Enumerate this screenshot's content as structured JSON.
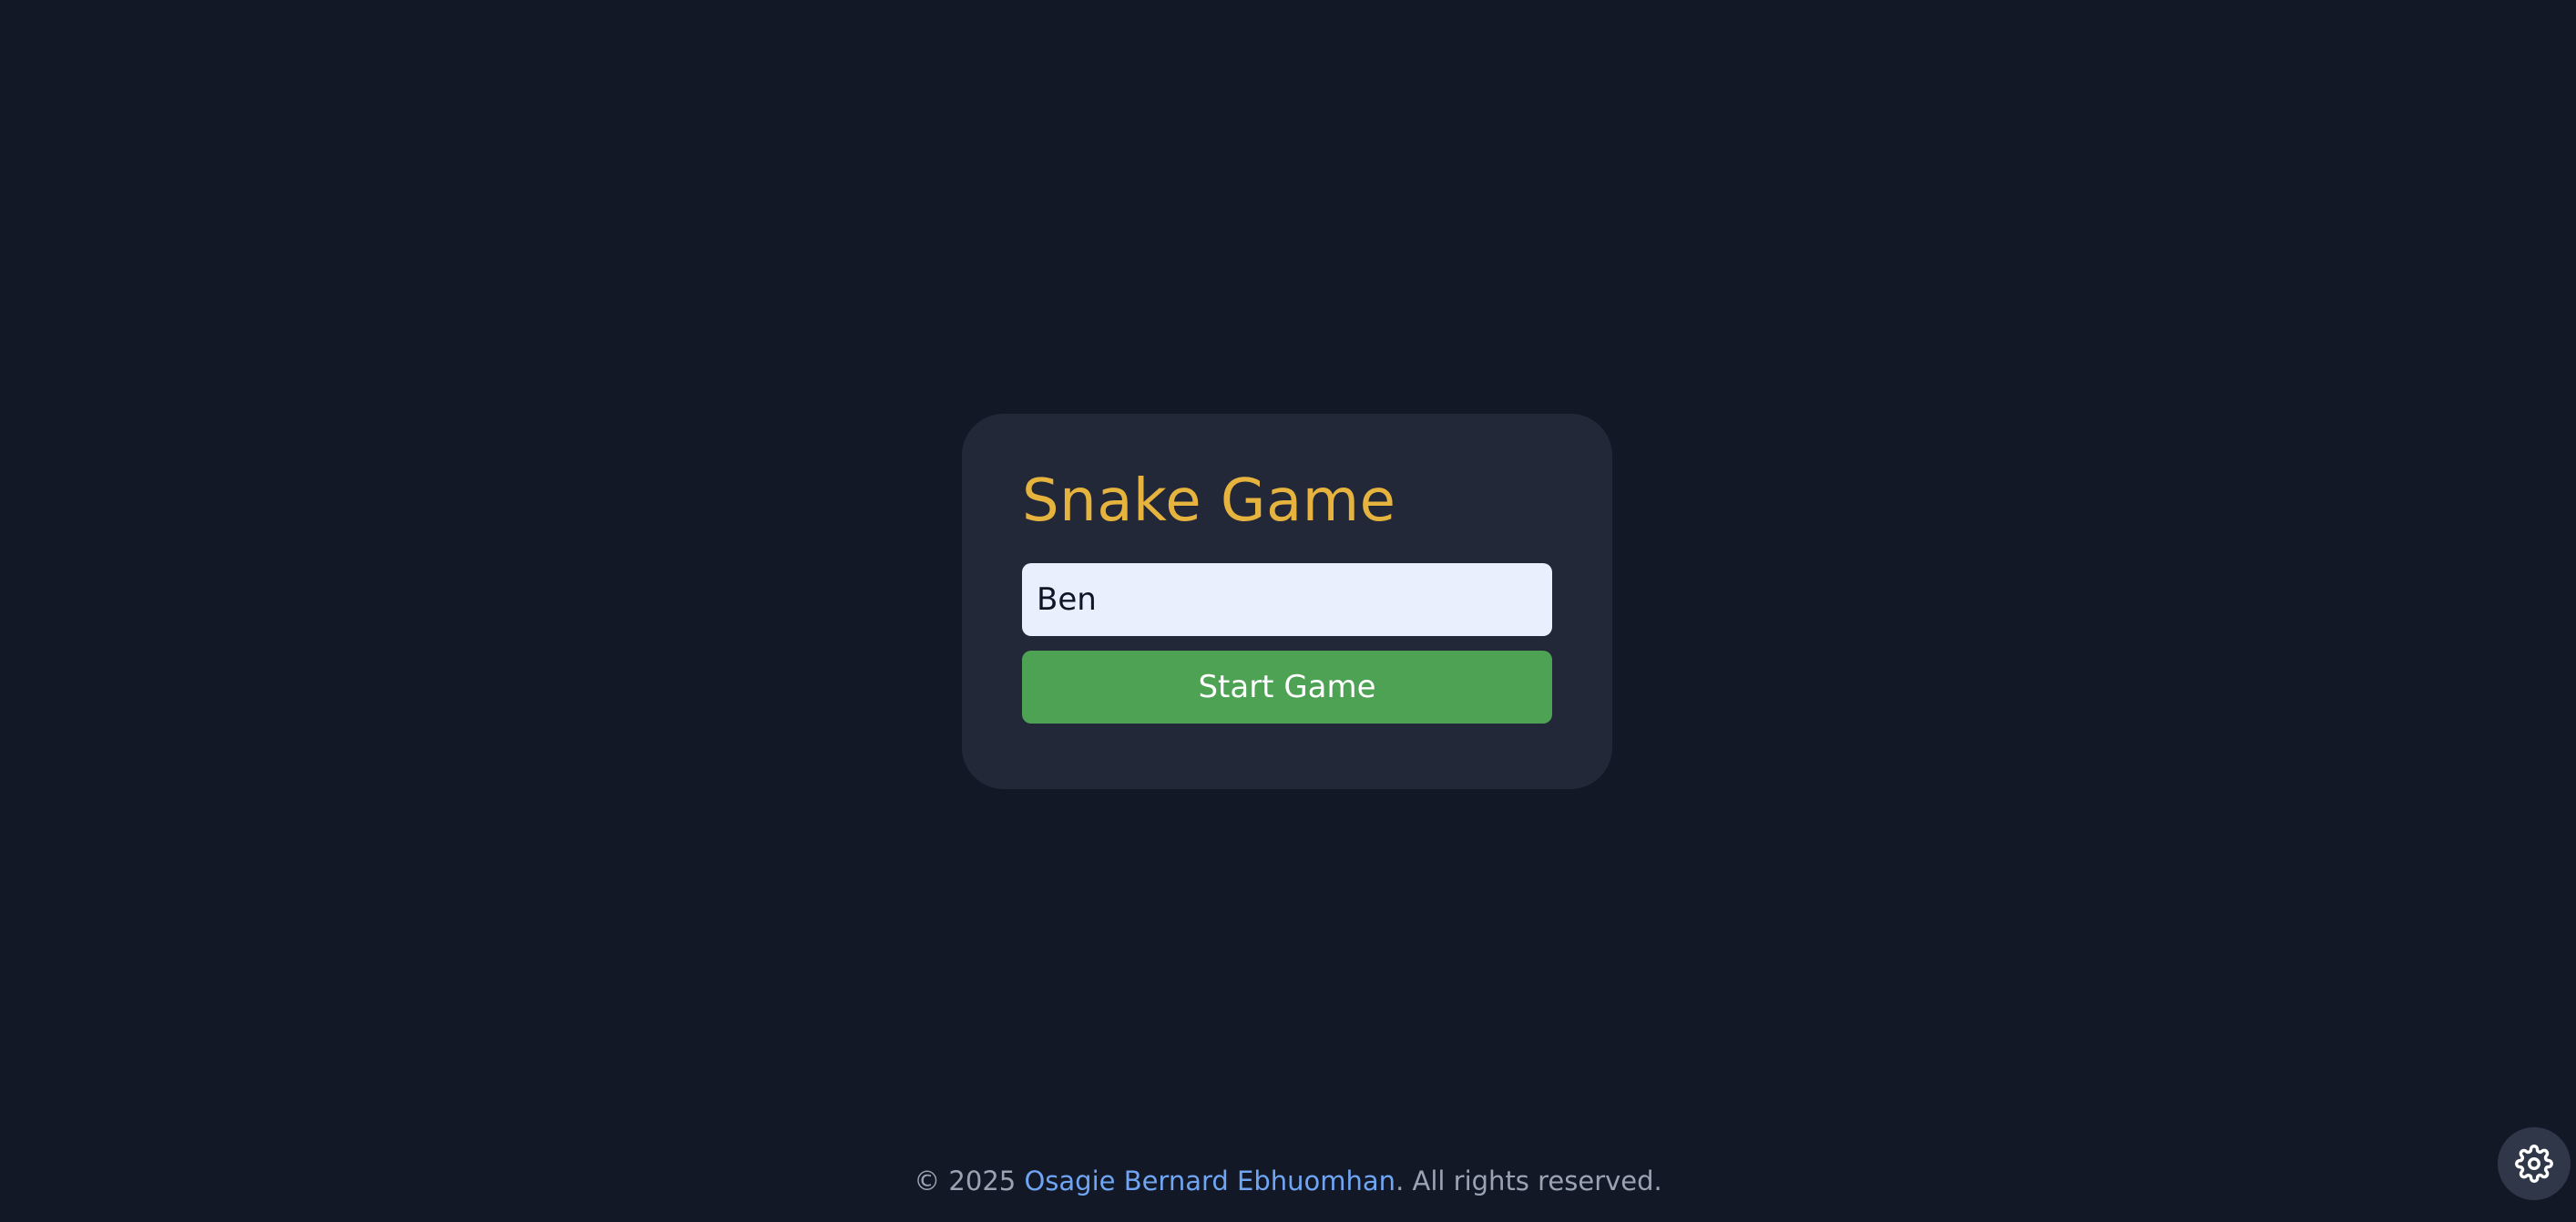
{
  "app": {
    "title": "Snake Game"
  },
  "form": {
    "name_value": "Ben",
    "start_label": "Start Game"
  },
  "footer": {
    "prefix": "© 2025 ",
    "author": "Osagie Bernard Ebhuomhan",
    "suffix": ". All rights reserved."
  },
  "settings": {
    "icon": "gear-icon"
  },
  "colors": {
    "background": "#121826",
    "card": "#222837",
    "title": "#E5B33E",
    "input_bg": "#E9EFFD",
    "button": "#4DA254",
    "link": "#6FA5F3",
    "footer_text": "#9aa3b3"
  }
}
